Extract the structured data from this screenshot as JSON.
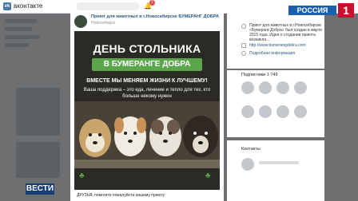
{
  "vk": {
    "title": "вконтакте",
    "logo_text": "vk",
    "notifications_count": "1"
  },
  "post": {
    "group_name": "Приют для животных в г.Новосибирске БУМЕРАНГ ДОБРА",
    "group_subtitle": "Новосибирск",
    "poster_title": "ДЕНЬ СТОЛЬНИКА",
    "poster_banner": "В БУМЕРАНГЕ ДОБРА",
    "poster_slogan": "ВМЕСТЕ МЫ МЕНЯЕМ ЖИЗНИ К ЛУЧШЕМУ!",
    "poster_support": "Ваша поддержка – это еда, лечение и тепло для тех, кто больше некому нужен",
    "caption": "ДРУЗЬЯ, помогите пожалуйста нашему приюту"
  },
  "info": {
    "description": "Приют для животных в г.Новосибирске «Бумеранг Добра» был создан в марте 2015 года. Идея о создании приюта возникла...",
    "link": "http://www.bumerangdobra.com",
    "more": "Подробная информация"
  },
  "subscribers": {
    "label": "Подписчики 1 749"
  },
  "contacts": {
    "label": "Контакты"
  },
  "tv": {
    "channel": "РОССИЯ",
    "channel_number": "1",
    "program": "ВЕСТИ"
  },
  "colors": {
    "vk_blue": "#4a76a8",
    "banner_green": "#5aa64a",
    "rossia_red": "#c8102e",
    "rossia_blue": "#1b5fae"
  },
  "icons": [
    "bell-icon",
    "info-icon",
    "link-icon",
    "clover-icon"
  ]
}
